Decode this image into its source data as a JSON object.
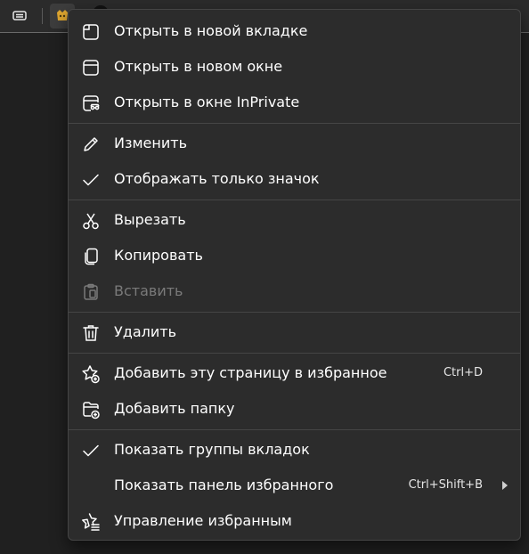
{
  "favorites_bar": {
    "tab_actions_icon": "tab-actions-icon",
    "site_icon": "site-favicon-icon"
  },
  "menu": {
    "groups": [
      [
        {
          "label": "Открыть в новой вкладке",
          "icon": "new-tab-icon"
        },
        {
          "label": "Открыть в новом окне",
          "icon": "new-window-icon"
        },
        {
          "label": "Открыть в окне InPrivate",
          "icon": "inprivate-icon"
        }
      ],
      [
        {
          "label": "Изменить",
          "icon": "pencil-icon"
        },
        {
          "label": "Отображать только значок",
          "icon": "checkmark-icon"
        }
      ],
      [
        {
          "label": "Вырезать",
          "icon": "scissors-icon"
        },
        {
          "label": "Копировать",
          "icon": "copy-icon"
        },
        {
          "label": "Вставить",
          "icon": "paste-icon",
          "disabled": true
        }
      ],
      [
        {
          "label": "Удалить",
          "icon": "trash-icon"
        }
      ],
      [
        {
          "label": "Добавить эту страницу в избранное",
          "icon": "star-add-icon",
          "shortcut": "Ctrl+D"
        },
        {
          "label": "Добавить папку",
          "icon": "folder-add-icon"
        }
      ],
      [
        {
          "label": "Показать группы вкладок",
          "icon": "checkmark-icon"
        },
        {
          "label": "Показать панель избранного",
          "shortcut": "Ctrl+Shift+B",
          "submenu": true
        },
        {
          "label": "Управление избранным",
          "icon": "star-manage-icon"
        }
      ]
    ]
  }
}
